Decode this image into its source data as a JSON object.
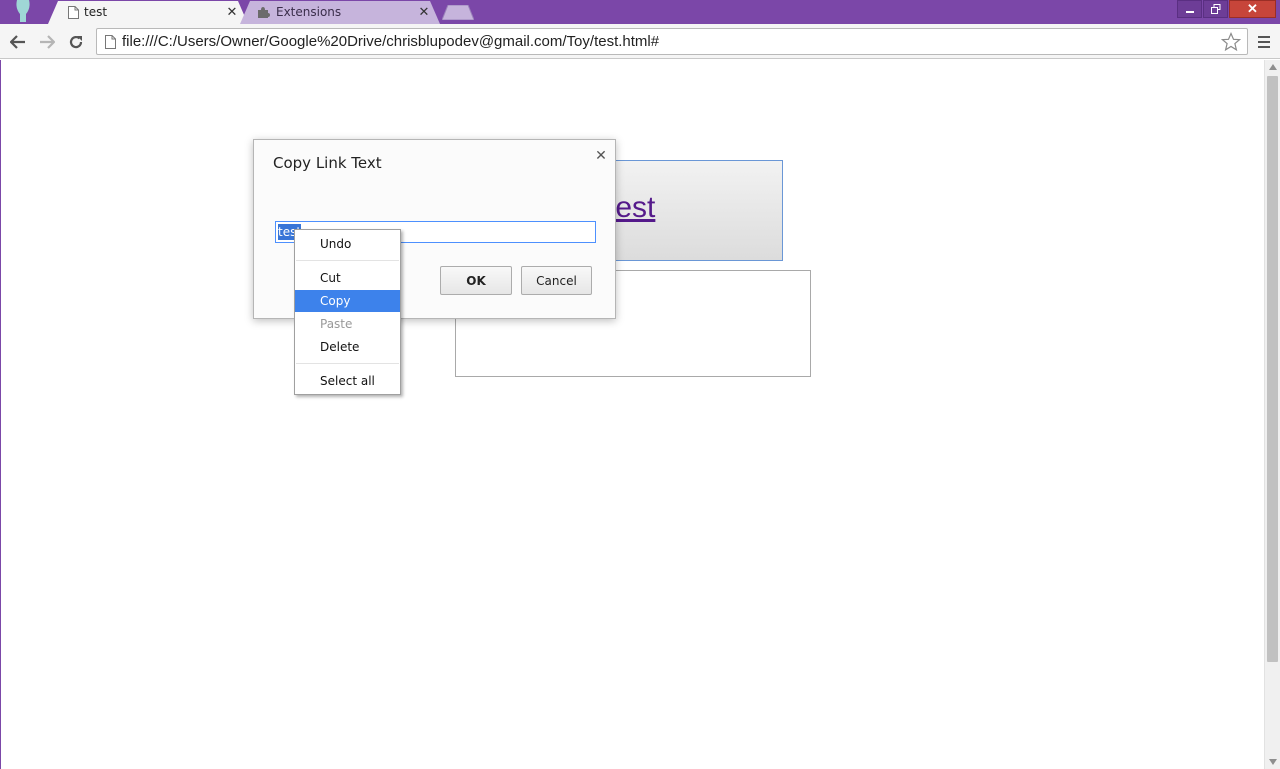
{
  "browser": {
    "tabs": [
      {
        "label": "test",
        "active": true
      },
      {
        "label": "Extensions",
        "active": false
      }
    ],
    "address_url": "file:///C:/Users/Owner/Google%20Drive/chrisblupodev@gmail.com/Toy/test.html#"
  },
  "page": {
    "link_text": "test"
  },
  "dialog": {
    "title": "Copy Link Text",
    "input_value": "test",
    "ok_label": "OK",
    "cancel_label": "Cancel"
  },
  "context_menu": {
    "items": [
      {
        "label": "Undo",
        "enabled": true
      },
      {
        "label": "Cut",
        "enabled": true
      },
      {
        "label": "Copy",
        "enabled": true,
        "highlighted": true
      },
      {
        "label": "Paste",
        "enabled": false
      },
      {
        "label": "Delete",
        "enabled": true
      },
      {
        "label": "Select all",
        "enabled": true
      }
    ]
  },
  "colors": {
    "frame": "#7b47a8",
    "highlight": "#3d82eb",
    "link": "#551a8b"
  }
}
